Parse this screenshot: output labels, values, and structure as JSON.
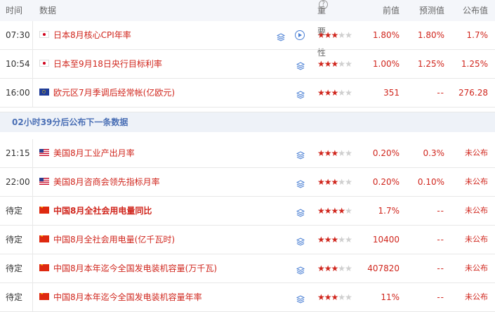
{
  "header": {
    "time": "时间",
    "data": "数据",
    "importance": "重要性",
    "help_icon": "?",
    "previous": "前值",
    "forecast": "预测值",
    "actual": "公布值"
  },
  "notice": "02小时39分后公布下一条数据",
  "rows_top": [
    {
      "time": "07:30",
      "flag": "jp",
      "name": "日本8月核心CPI年率",
      "bold": false,
      "stars": 3,
      "icons": [
        "layers-icon",
        "play-icon"
      ],
      "previous": "1.80%",
      "forecast": "1.80%",
      "actual": "1.7%"
    },
    {
      "time": "10:54",
      "flag": "jp",
      "name": "日本至9月18日央行目标利率",
      "bold": false,
      "stars": 3,
      "icons": [
        "layers-icon"
      ],
      "previous": "1.00%",
      "forecast": "1.25%",
      "actual": "1.25%"
    },
    {
      "time": "16:00",
      "flag": "eu",
      "name": "欧元区7月季调后经常帐(亿欧元)",
      "bold": false,
      "stars": 3,
      "icons": [
        "layers-icon"
      ],
      "previous": "351",
      "forecast": "--",
      "actual": "276.28"
    }
  ],
  "rows_bottom": [
    {
      "time": "21:15",
      "flag": "us",
      "name": "美国8月工业产出月率",
      "bold": false,
      "stars": 3,
      "icons": [
        "layers-icon"
      ],
      "previous": "0.20%",
      "forecast": "0.3%",
      "actual": "未公布"
    },
    {
      "time": "22:00",
      "flag": "us",
      "name": "美国8月咨商会领先指标月率",
      "bold": false,
      "stars": 3,
      "icons": [
        "layers-icon"
      ],
      "previous": "0.20%",
      "forecast": "0.10%",
      "actual": "未公布"
    },
    {
      "time": "待定",
      "flag": "cn",
      "name": "中国8月全社会用电量同比",
      "bold": true,
      "stars": 4,
      "icons": [
        "layers-icon"
      ],
      "previous": "1.7%",
      "forecast": "--",
      "actual": "未公布"
    },
    {
      "time": "待定",
      "flag": "cn",
      "name": "中国8月全社会用电量(亿千瓦时)",
      "bold": false,
      "stars": 3,
      "icons": [
        "layers-icon"
      ],
      "previous": "10400",
      "forecast": "--",
      "actual": "未公布"
    },
    {
      "time": "待定",
      "flag": "cn",
      "name": "中国8月本年迄今全国发电装机容量(万千瓦)",
      "bold": false,
      "stars": 3,
      "icons": [
        "layers-icon"
      ],
      "previous": "407820",
      "forecast": "--",
      "actual": "未公布"
    },
    {
      "time": "待定",
      "flag": "cn",
      "name": "中国8月本年迄今全国发电装机容量年率",
      "bold": false,
      "stars": 3,
      "icons": [
        "layers-icon"
      ],
      "previous": "11%",
      "forecast": "--",
      "actual": "未公布"
    }
  ],
  "colors": {
    "accent_red": "#d0261d",
    "notice_blue": "#4a6fb5",
    "header_bg": "#f4f6fa"
  }
}
